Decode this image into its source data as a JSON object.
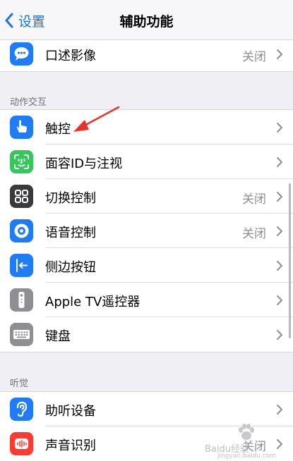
{
  "nav": {
    "back_label": "设置",
    "title": "辅助功能"
  },
  "rows_top": [
    {
      "label": "口述影像",
      "value": "关闭"
    }
  ],
  "section_interaction": {
    "header": "动作交互"
  },
  "interaction_rows": [
    {
      "label": "触控",
      "value": ""
    },
    {
      "label": "面容ID与注视",
      "value": ""
    },
    {
      "label": "切换控制",
      "value": "关闭"
    },
    {
      "label": "语音控制",
      "value": "关闭"
    },
    {
      "label": "侧边按钮",
      "value": ""
    },
    {
      "label": "Apple TV遥控器",
      "value": ""
    },
    {
      "label": "键盘",
      "value": ""
    }
  ],
  "section_hearing": {
    "header": "听觉"
  },
  "hearing_rows": [
    {
      "label": "助听设备",
      "value": ""
    },
    {
      "label": "声音识别",
      "value": "关闭"
    }
  ],
  "watermark": {
    "text": "Baidu经验",
    "url": "jingyan.baidu.com"
  },
  "colors": {
    "accent": "#1a73e8",
    "icon_blue": "#1f7cf5",
    "icon_green": "#34c759",
    "icon_dark": "#3a3a3c",
    "icon_gray": "#8e8e93",
    "icon_red": "#ff3b30",
    "annotation_arrow": "#e8322b"
  }
}
